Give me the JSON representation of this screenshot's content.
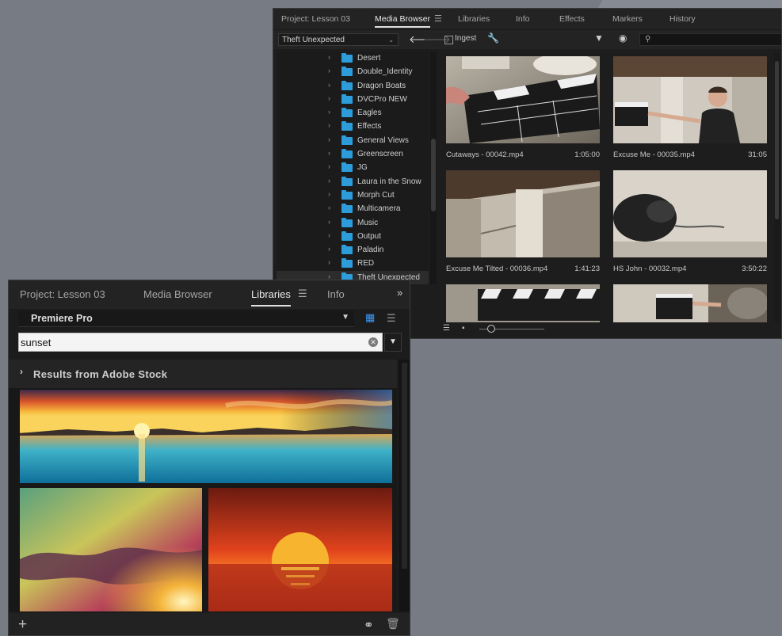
{
  "media_browser": {
    "tabs": [
      {
        "label": "Project: Lesson 03"
      },
      {
        "label": "Media Browser"
      },
      {
        "label": "Libraries"
      },
      {
        "label": "Info"
      },
      {
        "label": "Effects"
      },
      {
        "label": "Markers"
      },
      {
        "label": "History"
      }
    ],
    "location": "Theft Unexpected",
    "ingest_label": "Ingest",
    "folders": [
      "Desert",
      "Double_Identity",
      "Dragon Boats",
      "DVCPro NEW",
      "Eagles",
      "Effects",
      "General Views",
      "Greenscreen",
      "JG",
      "Laura in the Snow",
      "Morph Cut",
      "Multicamera",
      "Music",
      "Output",
      "Paladin",
      "RED",
      "Theft Unexpected"
    ],
    "clips": [
      {
        "name": "Cutaways - 00042.mp4",
        "duration": "1:05:00"
      },
      {
        "name": "Excuse Me - 00035.mp4",
        "duration": "31:05"
      },
      {
        "name": "Excuse Me Tilted - 00036.mp4",
        "duration": "1:41:23"
      },
      {
        "name": "HS John - 00032.mp4",
        "duration": "3:50:22"
      },
      {
        "name": "",
        "duration": ""
      },
      {
        "name": "",
        "duration": ""
      }
    ]
  },
  "libraries": {
    "tabs": [
      {
        "label": "Project: Lesson  03"
      },
      {
        "label": "Media Browser"
      },
      {
        "label": "Libraries"
      },
      {
        "label": "Info"
      }
    ],
    "library_name": "Premiere Pro",
    "search_value": "sunset",
    "results_header": "Results from Adobe Stock",
    "view_mode": "grid",
    "accent_color": "#3a9bff"
  },
  "icons": {
    "panel_menu": "hamburger-icon",
    "overflow": "chevron-double-right-icon",
    "folder_color": "#2d9cdb"
  }
}
